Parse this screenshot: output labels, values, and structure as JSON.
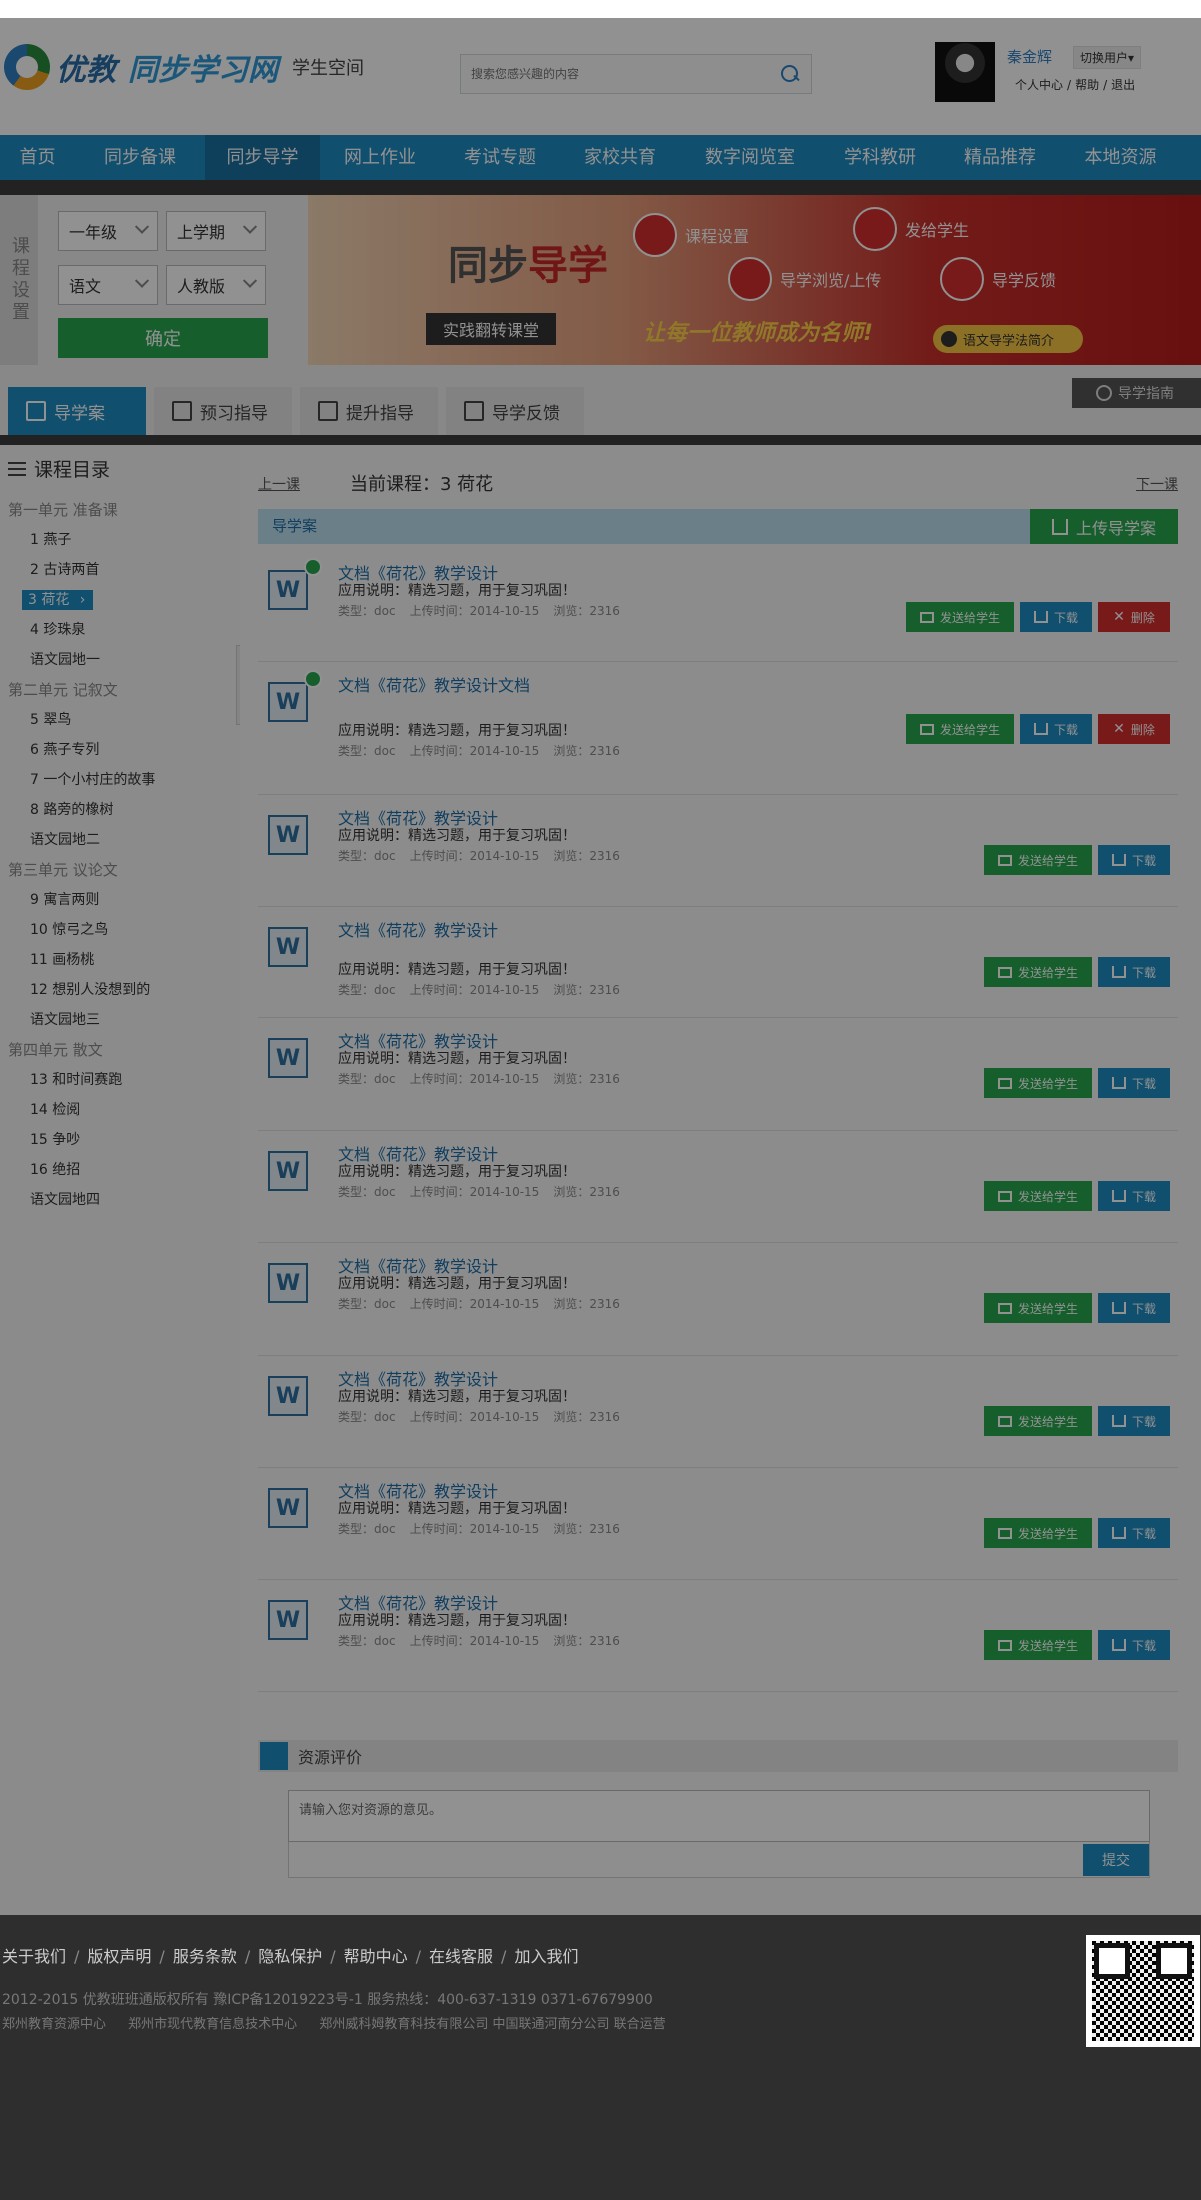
{
  "header": {
    "brand_main": "优教",
    "brand_sub": "同步学习网",
    "space_label": "学生空间",
    "search_placeholder": "搜索您感兴趣的内容",
    "user_name": "秦金辉",
    "switch_user": "切换用户▾",
    "links": [
      "个人中心",
      "帮助",
      "退出"
    ]
  },
  "nav": {
    "items": [
      "首页",
      "同步备课",
      "同步导学",
      "网上作业",
      "考试专题",
      "家校共育",
      "数字阅览室",
      "学科教研",
      "精品推荐",
      "本地资源"
    ],
    "active_index": 2
  },
  "course_settings": {
    "label": "课程设置",
    "grade": "一年级",
    "term": "上学期",
    "subject": "语文",
    "edition": "人教版",
    "confirm": "确定"
  },
  "banner": {
    "title_a": "同步",
    "title_b": "导学",
    "button": "实践翻转课堂",
    "step1": "课程设置",
    "step2": "发给学生",
    "step3": "导学浏览/上传",
    "step4": "导学反馈",
    "slogan": "让每一位教师成为名师!",
    "intro": "语文导学法简介"
  },
  "tabs": {
    "items": [
      "导学案",
      "预习指导",
      "提升指导",
      "导学反馈"
    ],
    "active_index": 0,
    "guide": "导学指南"
  },
  "toc": {
    "title": "课程目录",
    "entries": [
      {
        "type": "unit",
        "text": "第一单元 准备课"
      },
      {
        "type": "lesson",
        "text": "1 燕子"
      },
      {
        "type": "lesson",
        "text": "2 古诗两首"
      },
      {
        "type": "lesson",
        "text": "3 荷花",
        "active": true
      },
      {
        "type": "lesson",
        "text": "4 珍珠泉"
      },
      {
        "type": "lesson",
        "text": "语文园地一"
      },
      {
        "type": "unit",
        "text": "第二单元 记叙文"
      },
      {
        "type": "lesson",
        "text": "5 翠鸟"
      },
      {
        "type": "lesson",
        "text": "6 燕子专列"
      },
      {
        "type": "lesson",
        "text": "7 一个小村庄的故事"
      },
      {
        "type": "lesson",
        "text": "8 路旁的橡树"
      },
      {
        "type": "lesson",
        "text": "语文园地二"
      },
      {
        "type": "unit",
        "text": "第三单元 议论文"
      },
      {
        "type": "lesson",
        "text": "9 寓言两则"
      },
      {
        "type": "lesson",
        "text": "10 惊弓之鸟"
      },
      {
        "type": "lesson",
        "text": "11 画杨桃"
      },
      {
        "type": "lesson",
        "text": "12 想别人没想到的"
      },
      {
        "type": "lesson",
        "text": "语文园地三"
      },
      {
        "type": "unit",
        "text": "第四单元 散文"
      },
      {
        "type": "lesson",
        "text": "13 和时间赛跑"
      },
      {
        "type": "lesson",
        "text": "14 检阅"
      },
      {
        "type": "lesson",
        "text": "15 争吵"
      },
      {
        "type": "lesson",
        "text": "16 绝招"
      },
      {
        "type": "lesson",
        "text": "语文园地四"
      }
    ]
  },
  "course_nav": {
    "prev": "上一课",
    "current": "当前课程：3 荷花",
    "next": "下一课"
  },
  "section": {
    "title": "导学案",
    "upload": "上传导学案"
  },
  "resources": [
    {
      "title": "文档《荷花》教学设计",
      "desc": "应用说明：精选习题，用于复习巩固！",
      "type": "类型：doc",
      "time": "上传时间：2014-10-15",
      "views": "浏览：2316",
      "own": true
    },
    {
      "title": "文档《荷花》教学设计文档",
      "desc": "应用说明：精选习题，用于复习巩固！",
      "type": "类型：doc",
      "time": "上传时间：2014-10-15",
      "views": "浏览：2316",
      "own": true
    },
    {
      "title": "文档《荷花》教学设计",
      "desc": "应用说明：精选习题，用于复习巩固！",
      "type": "类型：doc",
      "time": "上传时间：2014-10-15",
      "views": "浏览：2316",
      "own": false
    },
    {
      "title": "文档《荷花》教学设计",
      "desc": "应用说明：精选习题，用于复习巩固！",
      "type": "类型：doc",
      "time": "上传时间：2014-10-15",
      "views": "浏览：2316",
      "own": false
    },
    {
      "title": "文档《荷花》教学设计",
      "desc": "应用说明：精选习题，用于复习巩固！",
      "type": "类型：doc",
      "time": "上传时间：2014-10-15",
      "views": "浏览：2316",
      "own": false
    },
    {
      "title": "文档《荷花》教学设计",
      "desc": "应用说明：精选习题，用于复习巩固！",
      "type": "类型：doc",
      "time": "上传时间：2014-10-15",
      "views": "浏览：2316",
      "own": false
    },
    {
      "title": "文档《荷花》教学设计",
      "desc": "应用说明：精选习题，用于复习巩固！",
      "type": "类型：doc",
      "time": "上传时间：2014-10-15",
      "views": "浏览：2316",
      "own": false
    },
    {
      "title": "文档《荷花》教学设计",
      "desc": "应用说明：精选习题，用于复习巩固！",
      "type": "类型：doc",
      "time": "上传时间：2014-10-15",
      "views": "浏览：2316",
      "own": false
    },
    {
      "title": "文档《荷花》教学设计",
      "desc": "应用说明：精选习题，用于复习巩固！",
      "type": "类型：doc",
      "time": "上传时间：2014-10-15",
      "views": "浏览：2316",
      "own": false
    },
    {
      "title": "文档《荷花》教学设计",
      "desc": "应用说明：精选习题，用于复习巩固！",
      "type": "类型：doc",
      "time": "上传时间：2014-10-15",
      "views": "浏览：2316",
      "own": false
    }
  ],
  "actions": {
    "send": "发送给学生",
    "download": "下载",
    "delete": "删除"
  },
  "evaluation": {
    "title": "资源评价",
    "placeholder": "请输入您对资源的意见。",
    "submit": "提交"
  },
  "footer": {
    "links": [
      "关于我们",
      "版权声明",
      "服务条款",
      "隐私保护",
      "帮助中心",
      "在线客服",
      "加入我们"
    ],
    "copyright": "2012-2015 优教班班通版权所有 豫ICP备12019223号-1    服务热线：400-637-1319   0371-67679900",
    "corps": [
      "郑州教育资源中心",
      "郑州市现代教育信息技术中心",
      "郑州威科姆教育科技有限公司 中国联通河南分公司 联合运营"
    ]
  },
  "colors": {
    "nav": "#1e8bc3",
    "nav_active": "#1a6fa0",
    "green": "#27a84f",
    "red": "#d32f2f"
  }
}
